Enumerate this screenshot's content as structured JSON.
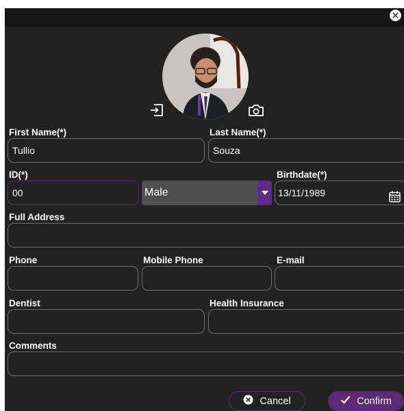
{
  "dialog": {
    "close_icon": "close-circle-icon",
    "photo_icons": {
      "import": "import-photo-icon",
      "camera": "camera-icon"
    }
  },
  "form": {
    "first_name": {
      "label": "First Name(*)",
      "value": "Tullio"
    },
    "last_name": {
      "label": "Last Name(*)",
      "value": "Souza"
    },
    "id": {
      "label": "ID(*)",
      "value": "00"
    },
    "gender": {
      "selected": "Male"
    },
    "birthdate": {
      "label": "Birthdate(*)",
      "value": "13/11/1989",
      "icon": "calendar-icon"
    },
    "full_address": {
      "label": "Full Address",
      "value": ""
    },
    "phone": {
      "label": "Phone",
      "value": ""
    },
    "mobile_phone": {
      "label": "Mobile Phone",
      "value": ""
    },
    "email": {
      "label": "E-mail",
      "value": ""
    },
    "dentist": {
      "label": "Dentist",
      "value": ""
    },
    "health_insurance": {
      "label": "Health Insurance",
      "value": ""
    },
    "comments": {
      "label": "Comments",
      "value": ""
    }
  },
  "actions": {
    "cancel_label": "Cancel",
    "confirm_label": "Confirm",
    "cancel_icon": "x-circle-icon",
    "confirm_icon": "checkmark-icon"
  },
  "colors": {
    "background": "#222222",
    "title_bar": "#141414",
    "accent_purple": "#5c2a72",
    "field_border": "#6e6e6e",
    "text": "#ffffff"
  }
}
